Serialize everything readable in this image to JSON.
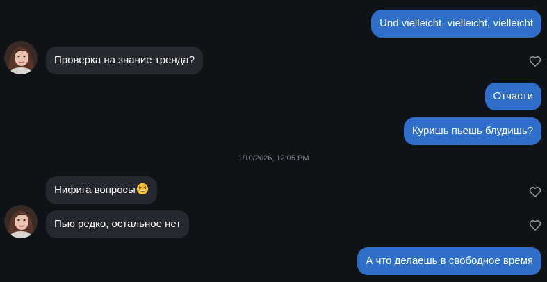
{
  "messages": {
    "m1": "Und vielleicht, vielleicht, vielleicht",
    "m2": "Проверка на знание тренда?",
    "m3": "Отчасти",
    "m4": "Куришь пьешь блудишь?",
    "m5": "Нифига вопросы",
    "m6": "Пью редко, остальное нет",
    "m7": "А что делаешь в свободное время"
  },
  "timestamp": "1/10/2026, 12:05 PM",
  "icons": {
    "heart": "heart-outline-icon",
    "emoji": "grinning-squinting-face-emoji"
  },
  "colors": {
    "background": "#0f1217",
    "outgoing_bubble": "#2f6fc9",
    "incoming_bubble": "#25282f",
    "timestamp_text": "#8b8f97"
  }
}
